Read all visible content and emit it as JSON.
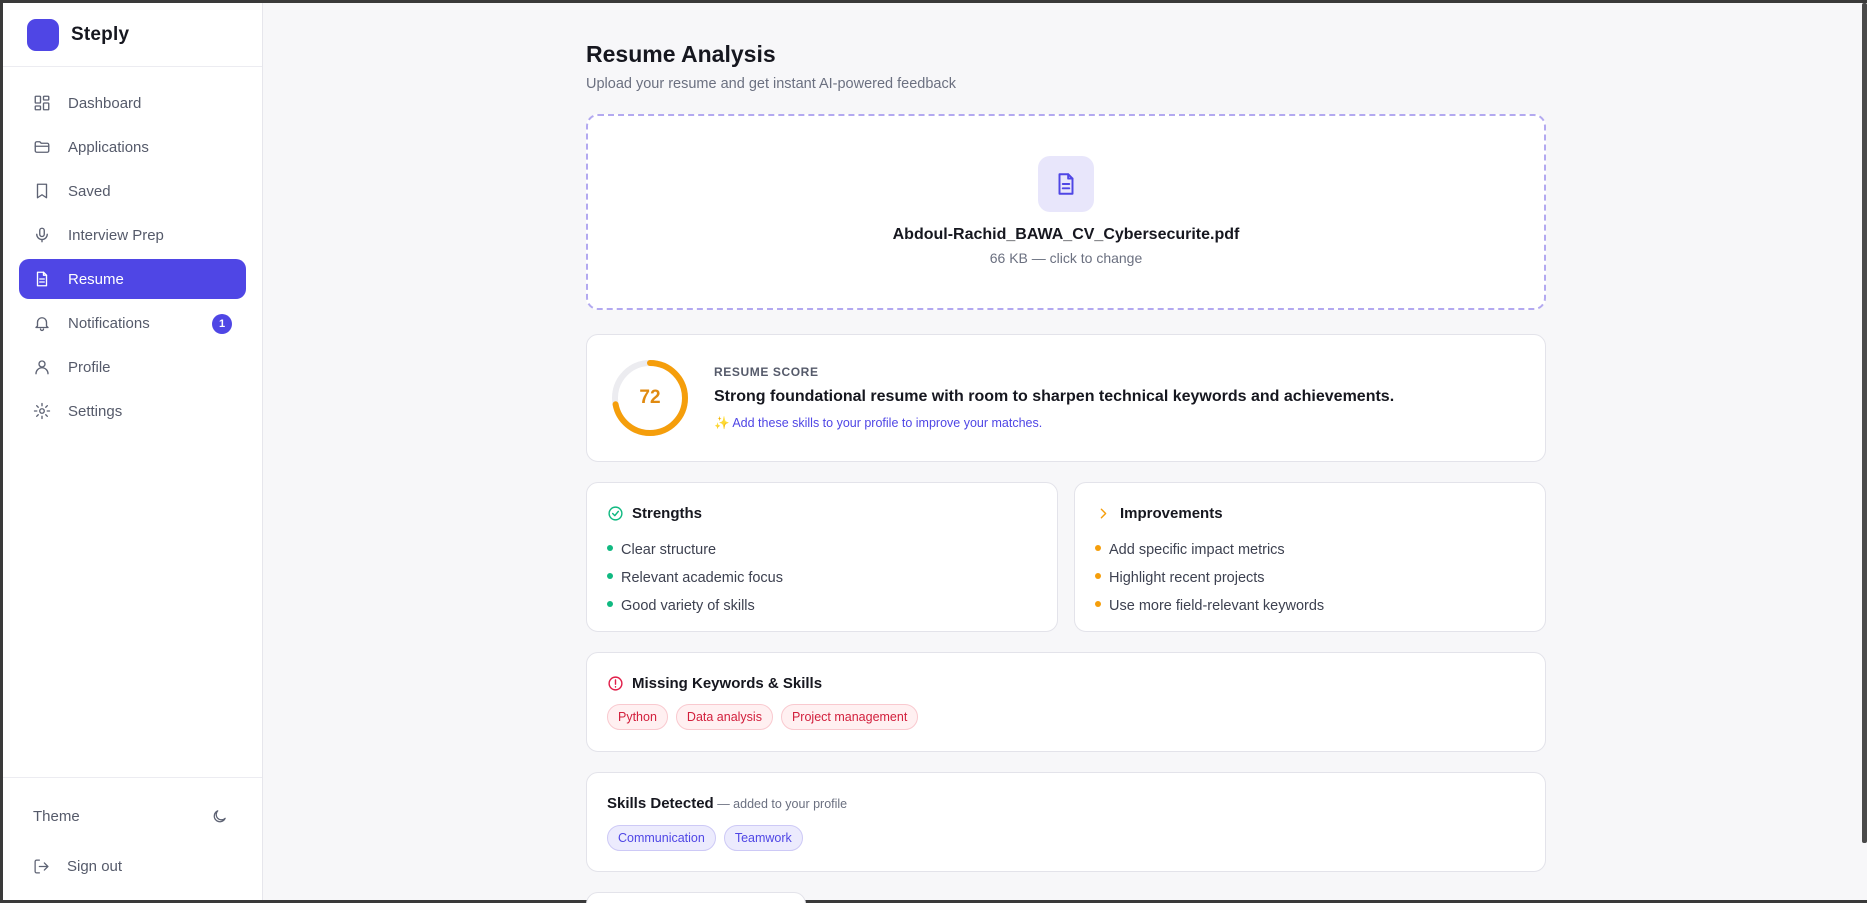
{
  "brand": {
    "name": "Steply",
    "logo_color": "#4f46e5"
  },
  "nav": {
    "items": [
      {
        "label": "Dashboard",
        "icon": "dashboard-icon"
      },
      {
        "label": "Applications",
        "icon": "folder-icon"
      },
      {
        "label": "Saved",
        "icon": "bookmark-icon"
      },
      {
        "label": "Interview Prep",
        "icon": "microphone-icon"
      },
      {
        "label": "Resume",
        "icon": "document-icon",
        "active": true
      },
      {
        "label": "Notifications",
        "icon": "bell-icon",
        "badge": "1"
      },
      {
        "label": "Profile",
        "icon": "user-icon"
      },
      {
        "label": "Settings",
        "icon": "gear-icon"
      }
    ],
    "theme_label": "Theme",
    "signout_label": "Sign out"
  },
  "page": {
    "title": "Resume Analysis",
    "subtitle": "Upload your resume and get instant AI-powered feedback"
  },
  "upload": {
    "file_name": "Abdoul-Rachid_BAWA_CV_Cybersecurite.pdf",
    "file_meta": "66 KB — click to change"
  },
  "score": {
    "label": "RESUME SCORE",
    "value": "72",
    "value_fraction": 0.72,
    "summary": "Strong foundational resume with room to sharpen technical keywords and achievements.",
    "tip": "✨ Add these skills to your profile to improve your matches.",
    "color": "#f59e0b"
  },
  "strengths": {
    "title": "Strengths",
    "items": [
      "Clear structure",
      "Relevant academic focus",
      "Good variety of skills"
    ]
  },
  "improvements": {
    "title": "Improvements",
    "items": [
      "Add specific impact metrics",
      "Highlight recent projects",
      "Use more field-relevant keywords"
    ]
  },
  "missing": {
    "title": "Missing Keywords & Skills",
    "chips": [
      "Python",
      "Data analysis",
      "Project management"
    ]
  },
  "skills": {
    "title": "Skills Detected",
    "note": " — added to your profile",
    "chips": [
      "Communication",
      "Teamwork"
    ]
  }
}
